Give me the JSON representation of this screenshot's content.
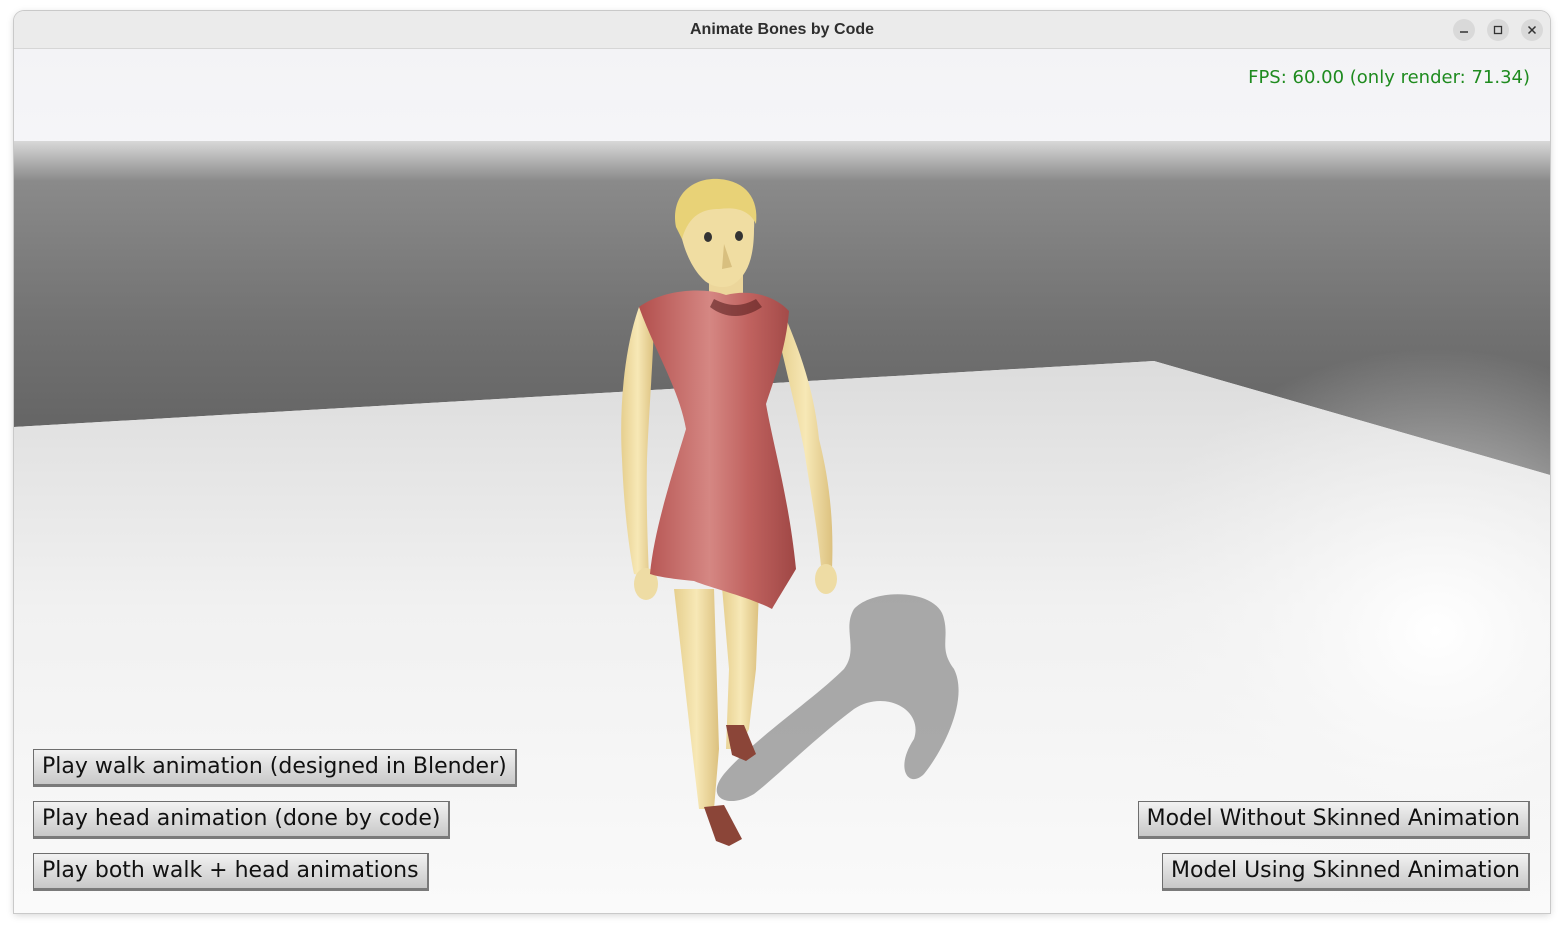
{
  "window": {
    "title": "Animate Bones by Code",
    "controls": [
      "minimize-icon",
      "maximize-icon",
      "close-icon"
    ]
  },
  "overlay": {
    "fps": "FPS: 60.00 (only render: 71.34)",
    "fps_color": "#1f8b1f"
  },
  "buttons_left": [
    {
      "label": "Play walk animation (designed in Blender)"
    },
    {
      "label": "Play head animation (done by code)"
    },
    {
      "label": "Play both walk + head animations"
    }
  ],
  "buttons_right": [
    {
      "label": "Model Without Skinned Animation"
    },
    {
      "label": "Model Using Skinned Animation"
    }
  ],
  "colors": {
    "dress": "#c0625f",
    "skin": "#f2dfa4",
    "hair": "#e8d277",
    "shoes": "#8b4538",
    "wall": "#7a7a7a",
    "floor": "#f0f0f0"
  }
}
